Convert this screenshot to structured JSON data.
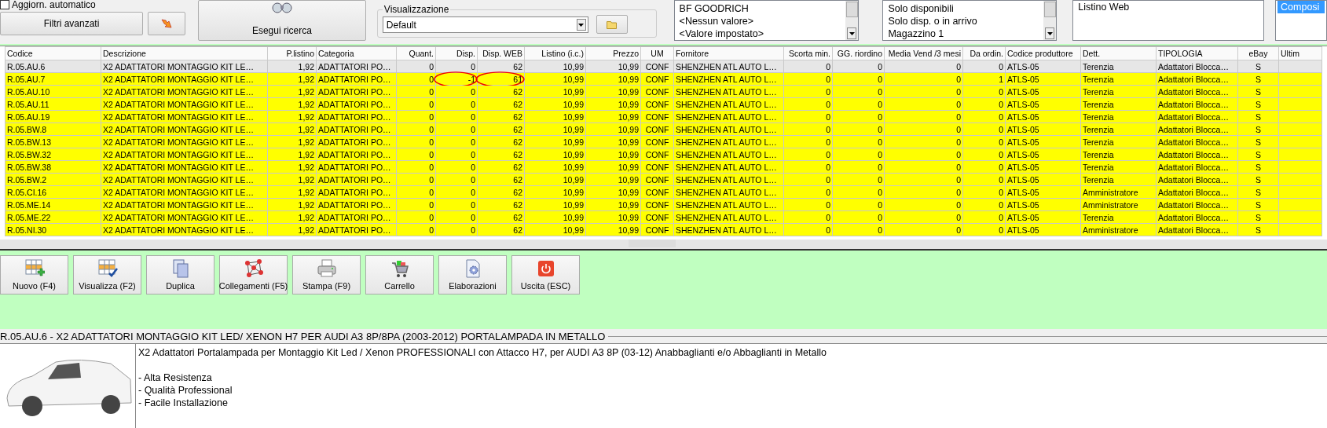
{
  "filters": {
    "auto_update": {
      "label": "Aggiorn. automatico",
      "checked": false
    },
    "advanced_filters": "Filtri avanzati",
    "search_button": "Esegui ricerca",
    "view": {
      "legend": "Visualizzazione",
      "value": "Default"
    },
    "brand_list": [
      {
        "label": "BF GOODRICH",
        "selected": false
      },
      {
        "label": "<Nessun valore>",
        "selected": false
      },
      {
        "label": "<Valore impostato>",
        "selected": false
      }
    ],
    "availability_list": [
      {
        "label": "Solo disponibili",
        "selected": false
      },
      {
        "label": "Solo disp. o in arrivo",
        "selected": false
      },
      {
        "label": "Magazzino 1",
        "selected": false
      }
    ],
    "price_list": [
      {
        "label": "Listino Web",
        "selected": false
      }
    ],
    "list_4": [
      {
        "label": "Composi",
        "selected": true
      }
    ]
  },
  "table": {
    "columns": [
      "Codice",
      "Descrizione",
      "P.listino",
      "Categoria",
      "Quant.",
      "Disp.",
      "Disp. WEB",
      "Listino (i.c.)",
      "Prezzo",
      "UM",
      "Fornitore",
      "Scorta min.",
      "GG. riordino",
      "Media Vend /3 mesi",
      "Da ordin.",
      "Codice produttore",
      "Dett.",
      "TIPOLOGIA",
      "eBay",
      "Ultim"
    ],
    "rows": [
      {
        "selected": true,
        "annotated": false,
        "cells": [
          "R.05.AU.6",
          "X2 ADATTATORI MONTAGGIO KIT LE…",
          "1,92",
          "ADATTATORI PO…",
          "0",
          "0",
          "62",
          "10,99",
          "10,99",
          "CONF",
          "SHENZHEN ATL AUTO L…",
          "0",
          "0",
          "0",
          "0",
          "ATLS-05",
          "Terenzia",
          "Adattatori Blocca…",
          "S"
        ]
      },
      {
        "selected": false,
        "annotated": true,
        "cells": [
          "R.05.AU.7",
          "X2 ADATTATORI MONTAGGIO KIT LE…",
          "1,92",
          "ADATTATORI PO…",
          "0",
          "-1",
          "61",
          "10,99",
          "10,99",
          "CONF",
          "SHENZHEN ATL AUTO L…",
          "0",
          "0",
          "0",
          "1",
          "ATLS-05",
          "Terenzia",
          "Adattatori Blocca…",
          "S"
        ]
      },
      {
        "selected": false,
        "annotated": false,
        "cells": [
          "R.05.AU.10",
          "X2 ADATTATORI MONTAGGIO KIT LE…",
          "1,92",
          "ADATTATORI PO…",
          "0",
          "0",
          "62",
          "10,99",
          "10,99",
          "CONF",
          "SHENZHEN ATL AUTO L…",
          "0",
          "0",
          "0",
          "0",
          "ATLS-05",
          "Terenzia",
          "Adattatori Blocca…",
          "S"
        ]
      },
      {
        "selected": false,
        "annotated": false,
        "cells": [
          "R.05.AU.11",
          "X2 ADATTATORI MONTAGGIO KIT LE…",
          "1,92",
          "ADATTATORI PO…",
          "0",
          "0",
          "62",
          "10,99",
          "10,99",
          "CONF",
          "SHENZHEN ATL AUTO L…",
          "0",
          "0",
          "0",
          "0",
          "ATLS-05",
          "Terenzia",
          "Adattatori Blocca…",
          "S"
        ]
      },
      {
        "selected": false,
        "annotated": false,
        "cells": [
          "R.05.AU.19",
          "X2 ADATTATORI MONTAGGIO KIT LE…",
          "1,92",
          "ADATTATORI PO…",
          "0",
          "0",
          "62",
          "10,99",
          "10,99",
          "CONF",
          "SHENZHEN ATL AUTO L…",
          "0",
          "0",
          "0",
          "0",
          "ATLS-05",
          "Terenzia",
          "Adattatori Blocca…",
          "S"
        ]
      },
      {
        "selected": false,
        "annotated": false,
        "cells": [
          "R.05.BW.8",
          "X2 ADATTATORI MONTAGGIO KIT LE…",
          "1,92",
          "ADATTATORI PO…",
          "0",
          "0",
          "62",
          "10,99",
          "10,99",
          "CONF",
          "SHENZHEN ATL AUTO L…",
          "0",
          "0",
          "0",
          "0",
          "ATLS-05",
          "Terenzia",
          "Adattatori Blocca…",
          "S"
        ]
      },
      {
        "selected": false,
        "annotated": false,
        "cells": [
          "R.05.BW.13",
          "X2 ADATTATORI MONTAGGIO KIT LE…",
          "1,92",
          "ADATTATORI PO…",
          "0",
          "0",
          "62",
          "10,99",
          "10,99",
          "CONF",
          "SHENZHEN ATL AUTO L…",
          "0",
          "0",
          "0",
          "0",
          "ATLS-05",
          "Terenzia",
          "Adattatori Blocca…",
          "S"
        ]
      },
      {
        "selected": false,
        "annotated": false,
        "cells": [
          "R.05.BW.32",
          "X2 ADATTATORI MONTAGGIO KIT LE…",
          "1,92",
          "ADATTATORI PO…",
          "0",
          "0",
          "62",
          "10,99",
          "10,99",
          "CONF",
          "SHENZHEN ATL AUTO L…",
          "0",
          "0",
          "0",
          "0",
          "ATLS-05",
          "Terenzia",
          "Adattatori Blocca…",
          "S"
        ]
      },
      {
        "selected": false,
        "annotated": false,
        "cells": [
          "R.05.BW.38",
          "X2 ADATTATORI MONTAGGIO KIT LE…",
          "1,92",
          "ADATTATORI PO…",
          "0",
          "0",
          "62",
          "10,99",
          "10,99",
          "CONF",
          "SHENZHEN ATL AUTO L…",
          "0",
          "0",
          "0",
          "0",
          "ATLS-05",
          "Terenzia",
          "Adattatori Blocca…",
          "S"
        ]
      },
      {
        "selected": false,
        "annotated": false,
        "cells": [
          "R.05.BW.2",
          "X2 ADATTATORI MONTAGGIO KIT LE…",
          "1,92",
          "ADATTATORI PO…",
          "0",
          "0",
          "62",
          "10,99",
          "10,99",
          "CONF",
          "SHENZHEN ATL AUTO L…",
          "0",
          "0",
          "0",
          "0",
          "ATLS-05",
          "Terenzia",
          "Adattatori Blocca…",
          "S"
        ]
      },
      {
        "selected": false,
        "annotated": false,
        "cells": [
          "R.05.CI.16",
          "X2 ADATTATORI MONTAGGIO KIT LE…",
          "1,92",
          "ADATTATORI PO…",
          "0",
          "0",
          "62",
          "10,99",
          "10,99",
          "CONF",
          "SHENZHEN ATL AUTO L…",
          "0",
          "0",
          "0",
          "0",
          "ATLS-05",
          "Amministratore",
          "Adattatori Blocca…",
          "S"
        ]
      },
      {
        "selected": false,
        "annotated": false,
        "cells": [
          "R.05.ME.14",
          "X2 ADATTATORI MONTAGGIO KIT LE…",
          "1,92",
          "ADATTATORI PO…",
          "0",
          "0",
          "62",
          "10,99",
          "10,99",
          "CONF",
          "SHENZHEN ATL AUTO L…",
          "0",
          "0",
          "0",
          "0",
          "ATLS-05",
          "Amministratore",
          "Adattatori Blocca…",
          "S"
        ]
      },
      {
        "selected": false,
        "annotated": false,
        "cells": [
          "R.05.ME.22",
          "X2 ADATTATORI MONTAGGIO KIT LE…",
          "1,92",
          "ADATTATORI PO…",
          "0",
          "0",
          "62",
          "10,99",
          "10,99",
          "CONF",
          "SHENZHEN ATL AUTO L…",
          "0",
          "0",
          "0",
          "0",
          "ATLS-05",
          "Terenzia",
          "Adattatori Blocca…",
          "S"
        ]
      },
      {
        "selected": false,
        "annotated": false,
        "cells": [
          "R.05.NI.30",
          "X2 ADATTATORI MONTAGGIO KIT LE…",
          "1,92",
          "ADATTATORI PO…",
          "0",
          "0",
          "62",
          "10,99",
          "10,99",
          "CONF",
          "SHENZHEN ATL AUTO L…",
          "0",
          "0",
          "0",
          "0",
          "ATLS-05",
          "Amministratore",
          "Adattatori Blocca…",
          "S"
        ]
      }
    ]
  },
  "toolbar": [
    {
      "label": "Nuovo (F4)",
      "kind": "new"
    },
    {
      "label": "Visualizza (F2)",
      "kind": "view"
    },
    {
      "label": "Duplica",
      "kind": "duplicate"
    },
    {
      "label": "Collegamenti (F5)",
      "kind": "links"
    },
    {
      "label": "Stampa (F9)",
      "kind": "print"
    },
    {
      "label": "Carrello",
      "kind": "cart"
    },
    {
      "label": "Elaborazioni",
      "kind": "process"
    },
    {
      "label": "Uscita (ESC)",
      "kind": "exit"
    }
  ],
  "product_title": "R.05.AU.6 - X2 ADATTATORI MONTAGGIO KIT LED/ XENON H7 PER AUDI A3 8P/8PA (2003-2012) PORTALAMPADA IN METALLO",
  "description": [
    "X2 Adattatori Portalampada per Montaggio Kit Led / Xenon PROFESSIONALI con Attacco H7, per AUDI A3 8P (03-12) Anabbaglianti e/o Abbaglianti in Metallo",
    "- Alta Resistenza",
    "- Qualità Professional",
    "- Facile Installazione"
  ]
}
